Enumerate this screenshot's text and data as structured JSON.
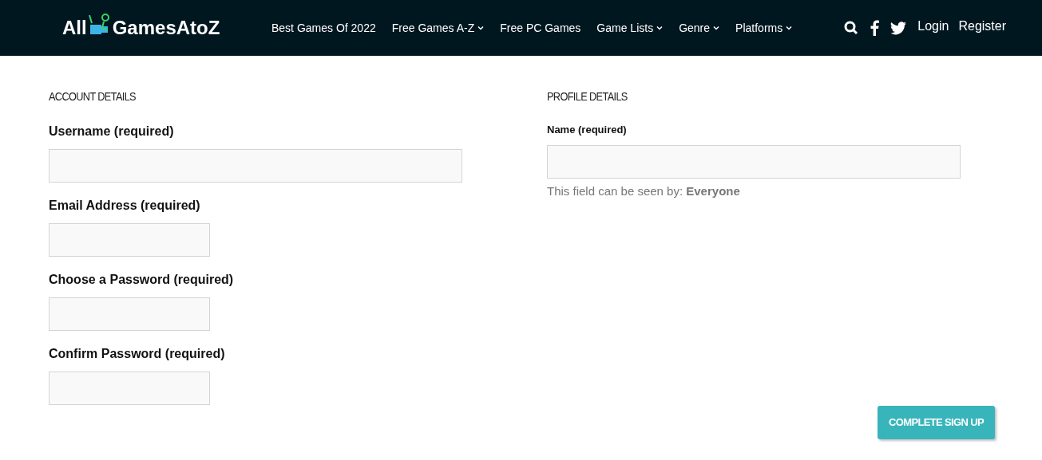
{
  "header": {
    "logo": {
      "left": "All",
      "right": "GamesAtoZ"
    },
    "nav": [
      {
        "label": "Best Games Of 2022",
        "dropdown": false
      },
      {
        "label": "Free Games A-Z",
        "dropdown": true
      },
      {
        "label": "Free PC Games",
        "dropdown": false
      },
      {
        "label": "Game Lists",
        "dropdown": true
      },
      {
        "label": "Genre",
        "dropdown": true
      },
      {
        "label": "Platforms",
        "dropdown": true
      }
    ],
    "account_links": [
      "Login",
      "Register"
    ]
  },
  "account_details": {
    "heading": "ACCOUNT DETAILS",
    "fields": [
      {
        "label": "Username (required)",
        "kind": "wide"
      },
      {
        "label": "Email Address (required)",
        "kind": "narrow"
      },
      {
        "label": "Choose a Password (required)",
        "kind": "narrow"
      },
      {
        "label": "Confirm Password (required)",
        "kind": "narrow"
      }
    ]
  },
  "profile_details": {
    "heading": "PROFILE DETAILS",
    "fields": [
      {
        "label": "Name (required)",
        "kind": "wide",
        "visibility_note": "This field can be seen by: **Everyone**"
      }
    ]
  },
  "submit_button": "COMPLETE SIGN UP"
}
